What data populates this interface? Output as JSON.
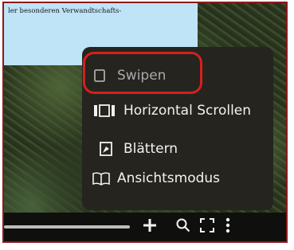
{
  "document": {
    "text_snippet": "ler besonderen Verwandtschafts-"
  },
  "view_menu": {
    "items": [
      {
        "label": "Swipen",
        "icon": "square-outline-icon",
        "highlighted": true
      },
      {
        "label": "Horizontal Scrollen",
        "icon": "horizontal-scroll-icon"
      },
      {
        "label": "Blättern",
        "icon": "page-flip-icon"
      },
      {
        "label": "Ansichtsmodus",
        "icon": "open-book-icon"
      }
    ]
  },
  "toolbar": {
    "zoom_in_icon": "plus-icon",
    "search_icon": "search-icon",
    "fullscreen_icon": "fullscreen-icon",
    "more_icon": "vertical-dots-icon"
  },
  "colors": {
    "highlight": "#d42020",
    "menu_background": "#25241f",
    "document_strip": "#bfe3f7"
  }
}
